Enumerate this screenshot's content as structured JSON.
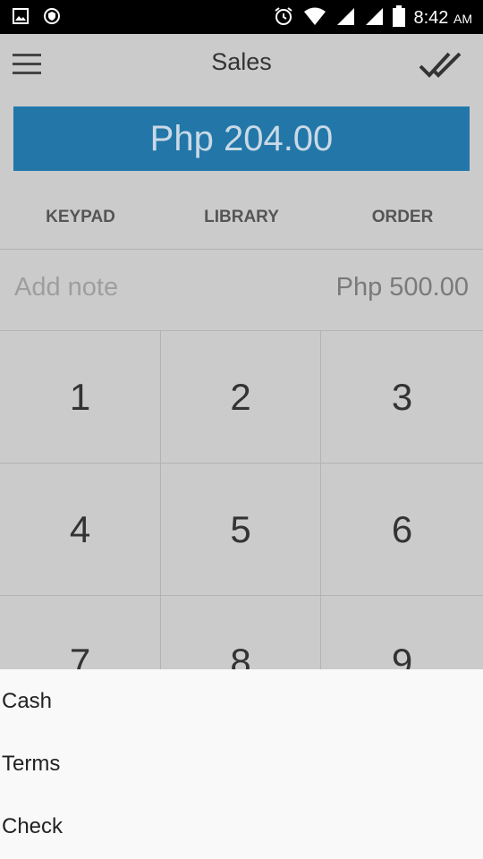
{
  "status_bar": {
    "time": "8:42",
    "ampm": "AM",
    "icons": [
      "image-icon",
      "shield-icon",
      "alarm-icon",
      "wifi-icon",
      "signal-icon",
      "signal-icon",
      "battery-icon"
    ]
  },
  "app_bar": {
    "title": "Sales",
    "menu_icon": "hamburger-menu-icon",
    "action_icon": "double-check-icon"
  },
  "total": {
    "label": "Php 204.00"
  },
  "tabs": [
    {
      "label": "KEYPAD"
    },
    {
      "label": "LIBRARY"
    },
    {
      "label": "ORDER"
    }
  ],
  "note": {
    "placeholder": "Add note",
    "amount": "Php 500.00"
  },
  "keypad": {
    "keys": [
      "1",
      "2",
      "3",
      "4",
      "5",
      "6",
      "7",
      "8",
      "9"
    ]
  },
  "payment_sheet": {
    "options": [
      "Cash",
      "Terms",
      "Check"
    ]
  },
  "colors": {
    "primary": "#2277a8",
    "background": "#cbcbcb",
    "sheet": "#f9f9f9"
  }
}
